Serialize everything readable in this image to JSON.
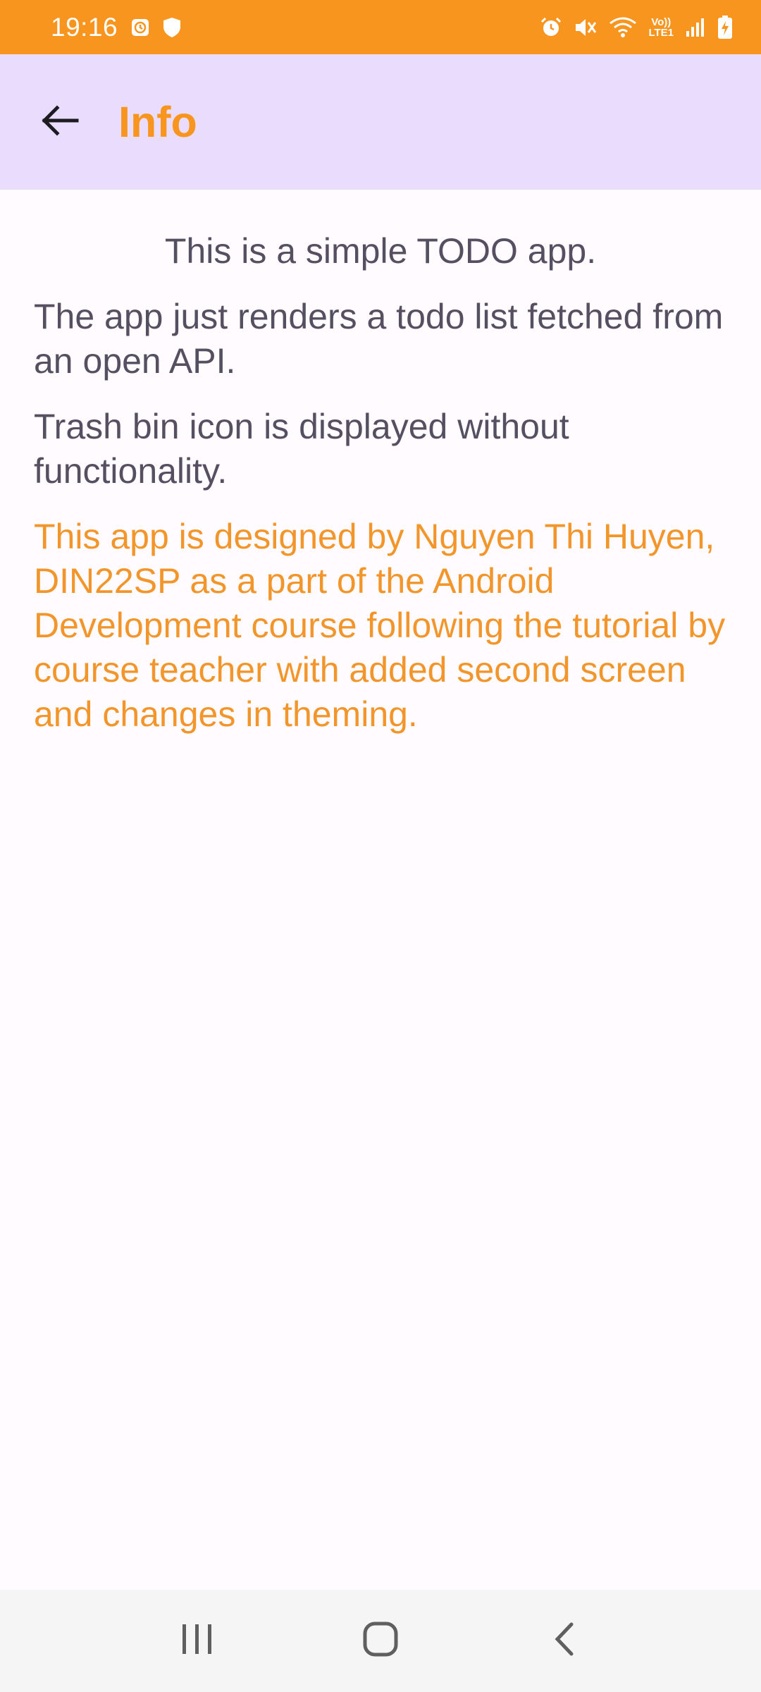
{
  "status_bar": {
    "time": "19:16",
    "network_label_top": "Vo))",
    "network_label_bottom": "LTE1",
    "icons": [
      "sync-icon",
      "shield-icon",
      "alarm-icon",
      "mute-icon",
      "wifi-icon",
      "signal-icon",
      "battery-charging-icon"
    ]
  },
  "app_bar": {
    "title": "Info",
    "back_icon": "arrow-left-icon"
  },
  "content": {
    "intro": "This is a simple TODO app.",
    "description": "The app just renders a todo list fetched from an open API.",
    "note": "Trash bin icon is displayed without functionality.",
    "credit": "This app is designed by Nguyen Thi Huyen, DIN22SP as a part of the Android Development course following the tutorial by course teacher with added second screen and changes in theming."
  },
  "colors": {
    "status_bar": "#f8951f",
    "app_bar": "#e9dcfd",
    "accent": "#f8951f",
    "body_text": "#545062",
    "background": "#fffbfe",
    "nav_bar": "#f5f5f5"
  },
  "nav_bar": {
    "icons": [
      "recent-apps-icon",
      "home-icon",
      "back-icon"
    ]
  }
}
